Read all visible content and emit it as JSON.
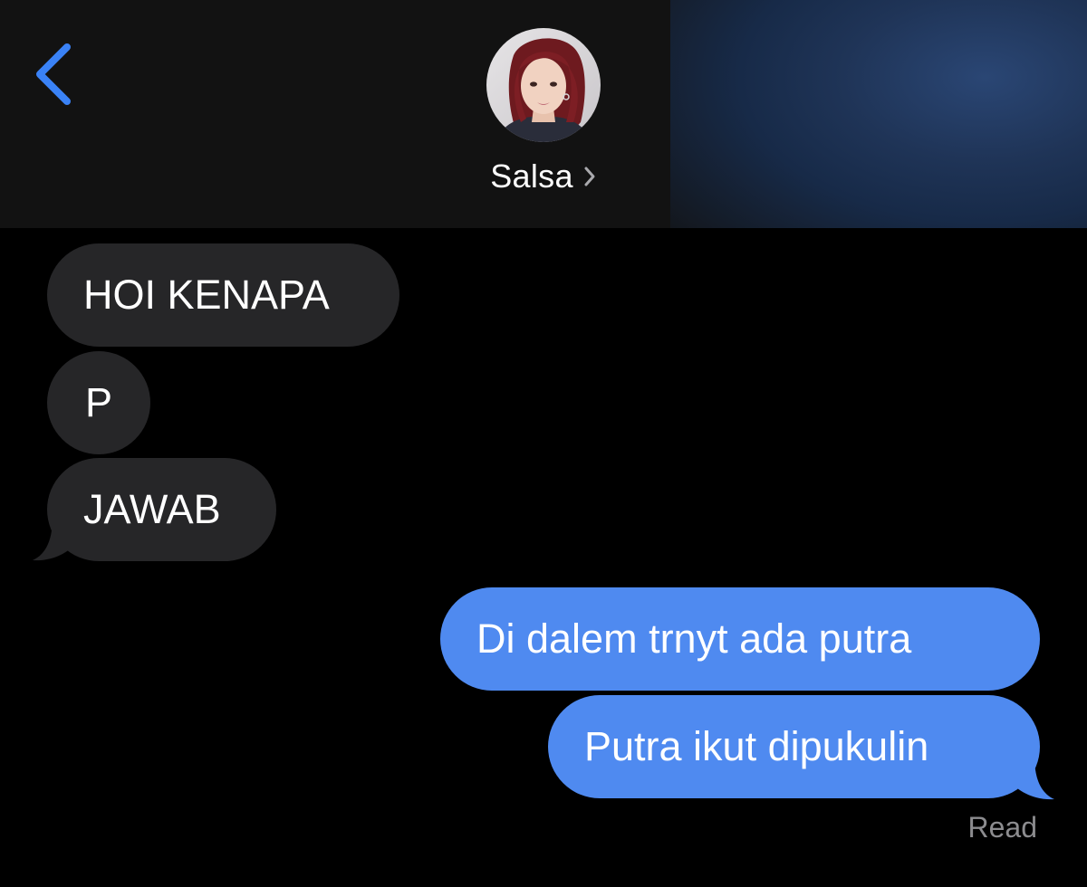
{
  "header": {
    "contact_name": "Salsa",
    "back_icon": "chevron-left-icon",
    "name_chevron_icon": "chevron-right-icon",
    "accent_color": "#3a82f6"
  },
  "messages": [
    {
      "direction": "incoming",
      "text": "HOI KENAPA"
    },
    {
      "direction": "incoming",
      "text": "P"
    },
    {
      "direction": "incoming",
      "text": "JAWAB"
    },
    {
      "direction": "outgoing",
      "text": "Di dalem trnyt ada putra"
    },
    {
      "direction": "outgoing",
      "text": "Putra ikut dipukulin"
    }
  ],
  "status": {
    "read_receipt": "Read"
  },
  "colors": {
    "incoming_bubble": "#262628",
    "outgoing_bubble": "#4f8af0",
    "background": "#000000"
  }
}
